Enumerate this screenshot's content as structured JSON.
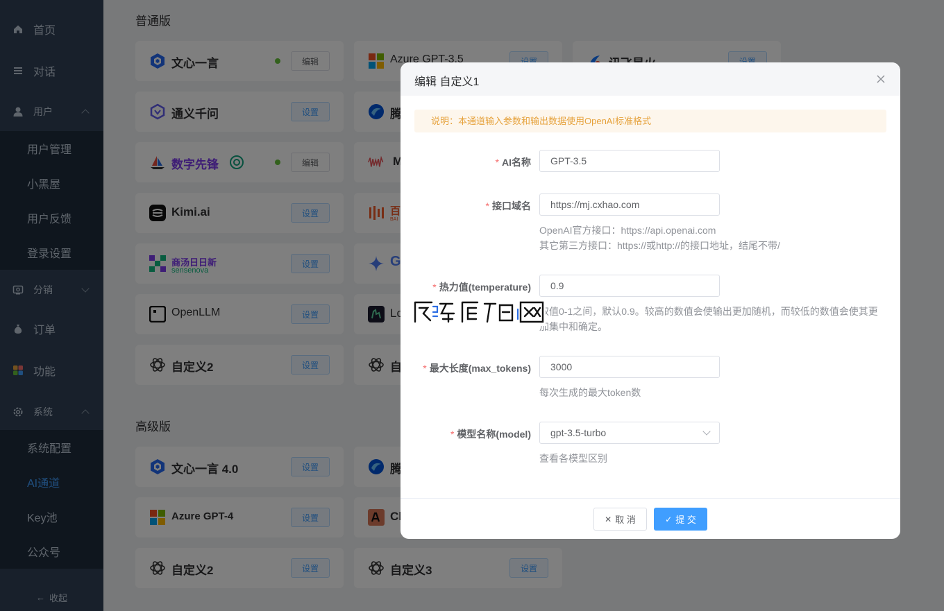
{
  "sidebar": {
    "home": "首页",
    "chat": "对话",
    "user": "用户",
    "user_items": [
      "用户管理",
      "小黑屋",
      "用户反馈",
      "登录设置"
    ],
    "distribution": "分销",
    "order": "订单",
    "feature": "功能",
    "system": "系统",
    "system_items": [
      "系统配置",
      "AI通道",
      "Key池",
      "公众号"
    ],
    "collapse": "收起"
  },
  "main": {
    "normal_title": "普通版",
    "premium_title": "高级版",
    "set_label": "设置",
    "edit_label": "编辑",
    "cards": [
      {
        "name": "文心一言"
      },
      {
        "name": "Azure GPT-3.5"
      },
      {
        "name": "讯飞星火"
      },
      {
        "name": "通义千问"
      },
      {
        "name": "腾"
      },
      {
        "name": "数字先锋"
      },
      {
        "name": "M"
      },
      {
        "name": "Kimi.ai"
      },
      {
        "name": "百"
      },
      {
        "name": "商汤日日新"
      },
      {
        "name": "G"
      },
      {
        "name": "OpenLLM"
      },
      {
        "name": "Lo"
      },
      {
        "name": "自定义2"
      },
      {
        "name": "自"
      }
    ],
    "premium_cards": [
      {
        "name": "文心一言 4.0"
      },
      {
        "name": "腾"
      },
      {
        "name": "Azure GPT-4"
      },
      {
        "name": "Cl"
      },
      {
        "name": "自定义2"
      },
      {
        "name": "自定义3"
      }
    ],
    "sensenova_sub": "sensenova",
    "baichuan_sub": "BAI"
  },
  "dialog": {
    "title": "编辑 自定义1",
    "notice": "说明：本通道输入参数和输出数据使用OpenAI标准格式",
    "ai_name_label": "AI名称",
    "ai_name_value": "GPT-3.5",
    "domain_label": "接口域名",
    "domain_value": "https://mj.cxhao.com",
    "domain_hint_1": "OpenAI官方接口：https://api.openai.com",
    "domain_hint_2": "其它第三方接口：https://或http://的接口地址，结尾不带/",
    "temp_label": "热力值(temperature)",
    "temp_value": "0.9",
    "temp_hint_1": "取值0-1之间，默认0.9。较高的数值会使输出更加随机，而较低的数值会使其更",
    "temp_hint_2": "加集中和确定。",
    "max_tokens_label": "最大长度(max_tokens)",
    "max_tokens_value": "3000",
    "max_tokens_hint": "每次生成的最大token数",
    "model_label": "模型名称(model)",
    "model_value": "gpt-3.5-turbo",
    "model_hint": "查看各模型区别",
    "cancel": "取 消",
    "submit": "提 交",
    "required_mark": "*"
  },
  "colors": {
    "sidebar_bg": "#304156",
    "submenu_bg": "#1f2d3d",
    "accent": "#409eff",
    "notice_text": "#e6a23c",
    "status_dot": "#67c23a"
  }
}
